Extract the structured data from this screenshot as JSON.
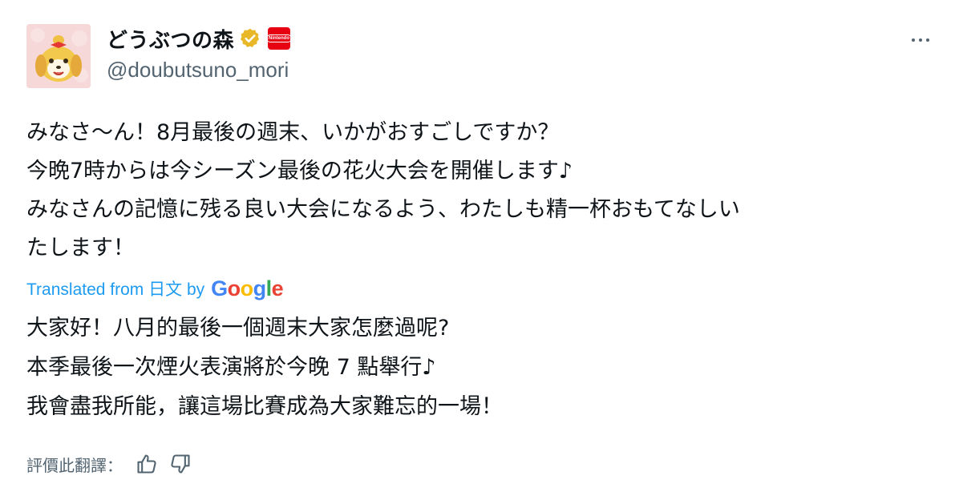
{
  "account": {
    "display_name": "どうぶつの森",
    "handle": "@doubutsuno_mori",
    "verified_icon": "gold-verified-badge-icon",
    "affiliate_logo": "Nintendo",
    "affiliate_color": "#e60012"
  },
  "post": {
    "text": "みなさ〜ん！8月最後の週末、いかがおすごしですか？\n今晩7時からは今シーズン最後の花火大会を開催します♪\nみなさんの記憶に残る良い大会になるよう、わたしも精一杯おもてなしい\nたします！"
  },
  "translation": {
    "label": "Translated from 日文 by",
    "provider": "Google",
    "text": "大家好！八月的最後一個週末大家怎麼過呢?\n本季最後一次煙火表演將於今晚 7 點舉行♪\n我會盡我所能，讓這場比賽成為大家難忘的一場！"
  },
  "rating": {
    "label": "評價此翻譯：",
    "like_icon": "thumbs-up-icon",
    "dislike_icon": "thumbs-down-icon"
  },
  "colors": {
    "link": "#1d9bf0",
    "secondary_text": "#536471",
    "text": "#0f1419"
  }
}
